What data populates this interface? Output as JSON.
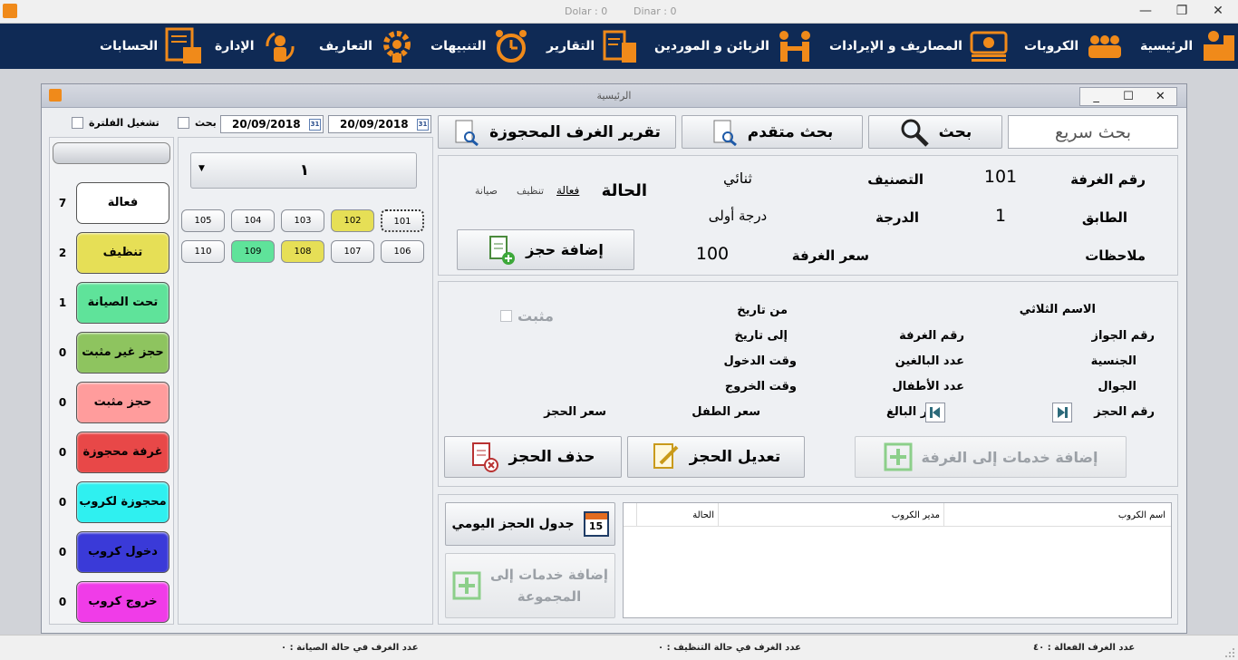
{
  "titlebar": {
    "dolar": "Dolar : 0",
    "dinar": "Dinar : 0",
    "min": "—",
    "restore": "❐",
    "close": "✕"
  },
  "menu": {
    "home": "الرئيسية",
    "groups": "الكروبات",
    "expenses": "المصاريف و الإيرادات",
    "customers": "الزبائن و الموردين",
    "reports": "التقارير",
    "alerts": "التنبيهات",
    "definitions": "التعاريف",
    "admin": "الإدارة",
    "accounts": "الحسابات"
  },
  "window": {
    "title": "الرئيسية",
    "min": "_",
    "max": "☐",
    "close": "✕"
  },
  "filter": {
    "run_filter": "تشغيل الفلترة",
    "search": "بحث",
    "date_from": "20/09/2018",
    "date_to": "20/09/2018",
    "cal": "31",
    "floor_selected": "١"
  },
  "toolbar": {
    "quick_search": "بحث سريع",
    "search": "بحث",
    "advanced_search": "بحث متقدم",
    "reserved_report": "تقرير الغرف المحجوزة"
  },
  "room_info": {
    "room_number_label": "رقم الغرفة",
    "room_number": "101",
    "category_label": "التصنيف",
    "category": "ثنائي",
    "floor_label": "الطابق",
    "floor": "1",
    "grade_label": "الدرجة",
    "grade": "درجة أولى",
    "notes_label": "ملاحظات",
    "price_label": "سعر الغرفة",
    "price": "100",
    "status_label": "الحالة",
    "status_active": "فعالة",
    "status_cleaning": "تنظيف",
    "status_maint": "صيانة",
    "add_booking": "إضافة حجز"
  },
  "booking": {
    "full_name": "الاسم الثلاثي",
    "passport": "رقم الجواز",
    "nationality": "الجنسية",
    "mobile": "الجوال",
    "booking_no": "رقم الحجز",
    "room_no": "رقم الغرفة",
    "adults": "عدد البالغين",
    "children": "عدد الأطفال",
    "adult_price": "سعر البالغ",
    "from_date": "من تاريخ",
    "to_date": "إلى تاريخ",
    "checkin_time": "وقت الدخول",
    "checkout_time": "وقت الخروج",
    "child_price": "سعر الطفل",
    "booking_price": "سعر الحجز",
    "confirmed": "مثبت",
    "add_services_room": "إضافة خدمات إلى الغرفة",
    "edit_booking": "تعديل الحجز",
    "delete_booking": "حذف الحجز"
  },
  "bottom": {
    "daily_schedule": "جدول الحجز اليومي",
    "cal_day": "15",
    "add_services_group_1": "إضافة خدمات إلى",
    "add_services_group_2": "المجموعة",
    "table_headers": [
      "اسم الكروب",
      "مدير الكروب",
      "الحالة"
    ]
  },
  "rooms": {
    "row1": [
      "101",
      "102",
      "103",
      "104",
      "105"
    ],
    "row2": [
      "106",
      "107",
      "108",
      "109",
      "110"
    ]
  },
  "legend": [
    {
      "label": "فعالة",
      "count": "7",
      "color": "#ffffff"
    },
    {
      "label": "تنظيف",
      "count": "2",
      "color": "#e6df56"
    },
    {
      "label": "تحت الصيانة",
      "count": "1",
      "color": "#5fe39a"
    },
    {
      "label": "حجز غير مثبت",
      "count": "0",
      "color": "#8ec45f"
    },
    {
      "label": "حجز مثبت",
      "count": "0",
      "color": "#ff9c9c"
    },
    {
      "label": "غرفة محجوزة",
      "count": "0",
      "color": "#e84848"
    },
    {
      "label": "محجوزة لكروب",
      "count": "0",
      "color": "#2ff0f0"
    },
    {
      "label": "دخول كروب",
      "count": "0",
      "color": "#3a3ad8"
    },
    {
      "label": "خروج كروب",
      "count": "0",
      "color": "#f03ce8"
    }
  ],
  "statusbar": {
    "active": "عدد الغرف الفعالة : ٤٠",
    "cleaning": "عدد الغرف في حالة التنظيف : ٠",
    "maintenance": "عدد الغرف في حالة الصيانة : ٠"
  },
  "colors": {
    "menu_bg": "#0f2a55",
    "icon_orange": "#f08a1a",
    "yellow_room": "#e6df56",
    "green_room": "#5fe39a"
  },
  "icons": [
    "home-icon",
    "groups-icon",
    "money-icon",
    "handshake-icon",
    "reports-icon",
    "alarm-icon",
    "gear-icon",
    "admin-icon",
    "accounts-icon",
    "search-icon",
    "document-search-icon",
    "add-document-icon",
    "delete-document-icon",
    "edit-document-icon",
    "calendar-icon",
    "plus-icon",
    "skip-first-icon",
    "skip-last-icon",
    "dropdown-arrow-icon"
  ]
}
